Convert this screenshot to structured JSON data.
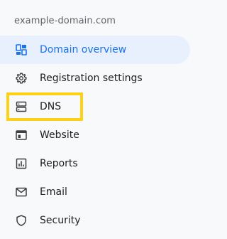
{
  "header": {
    "domain": "example-domain.com"
  },
  "nav": {
    "items": [
      {
        "label": "Domain overview",
        "icon": "dashboard-icon",
        "active": true
      },
      {
        "label": "Registration settings",
        "icon": "gear-icon",
        "active": false
      },
      {
        "label": "DNS",
        "icon": "dns-icon",
        "active": false
      },
      {
        "label": "Website",
        "icon": "website-icon",
        "active": false
      },
      {
        "label": "Reports",
        "icon": "reports-icon",
        "active": false
      },
      {
        "label": "Email",
        "icon": "email-icon",
        "active": false
      },
      {
        "label": "Security",
        "icon": "shield-icon",
        "active": false
      }
    ]
  },
  "colors": {
    "active_text": "#1a73e8",
    "active_bg": "#e8f0fe",
    "highlight": "#fcd116",
    "icon": "#3c4043"
  }
}
